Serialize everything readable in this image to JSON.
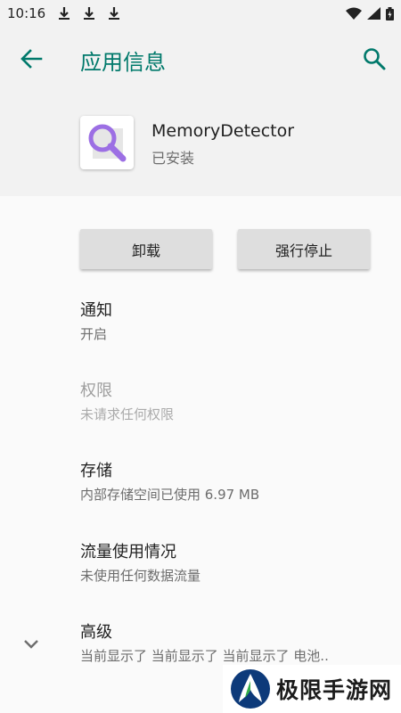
{
  "status_bar": {
    "time": "10:16",
    "icons": [
      "download-icon",
      "download-icon",
      "download-icon",
      "wifi-icon",
      "signal-icon",
      "battery-icon"
    ]
  },
  "app_bar": {
    "title": "应用信息",
    "accent_color": "#00796b"
  },
  "app": {
    "name": "MemoryDetector",
    "status": "已安装",
    "icon": "magnifier-icon"
  },
  "buttons": {
    "uninstall": "卸载",
    "force_stop": "强行停止"
  },
  "prefs": [
    {
      "title": "通知",
      "summary": "开启",
      "enabled": true
    },
    {
      "title": "权限",
      "summary": "未请求任何权限",
      "enabled": false
    },
    {
      "title": "存储",
      "summary": "内部存储空间已使用 6.97 MB",
      "enabled": true
    },
    {
      "title": "流量使用情况",
      "summary": "未使用任何数据流量",
      "enabled": true
    },
    {
      "title": "高级",
      "summary": "当前显示了 当前显示了 当前显示了 电池..",
      "enabled": true
    }
  ],
  "watermark": {
    "text": "极限手游网"
  }
}
